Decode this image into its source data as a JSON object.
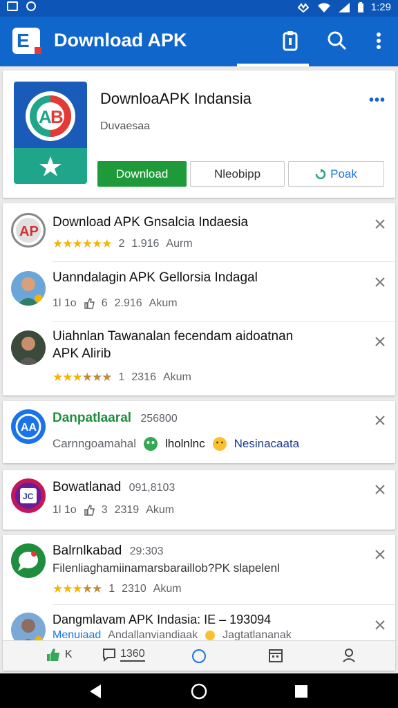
{
  "status_bar": {
    "time": "1:29"
  },
  "app_bar": {
    "title": "Download APK"
  },
  "featured": {
    "title": "DownloaAPK Indansia",
    "subtitle": "Duvaesaa",
    "more": "•••",
    "buttons": {
      "download": "Download",
      "second": "Nleobipp",
      "peak": "Poak"
    }
  },
  "list_card_1": {
    "items": [
      {
        "title": "Download APK Gnsalcia Indaesia",
        "rating_count": "2",
        "value": "1.916",
        "tag": "Aurm"
      },
      {
        "title": "Uanndalagin APK Gellorsia Indagal",
        "views": "1l 1o",
        "likes": "6",
        "value": "2.916",
        "tag": "Akum"
      },
      {
        "title_line1": "Uiahnlan Tawanalan fecendam aidoatnan",
        "title_line2": "APK Alirib",
        "rating_count": "1",
        "value": "2316",
        "tag": "Akum"
      }
    ]
  },
  "single_card": {
    "title": "Danpatlaaral",
    "number": "256800",
    "subtitle": "Carnngoamahal",
    "chip1": "lholnlnc",
    "chip2": "Nesinacaata"
  },
  "card_3": {
    "title": "Bowatlanad",
    "number": "091,8103",
    "views": "1l 1o",
    "likes": "3",
    "value": "2319",
    "tag": "Akum"
  },
  "card_4": {
    "title": "Balrnlkabad",
    "number": "29:303",
    "desc": "Filenliaghamiinamarsbaraillob?PK slapelenl",
    "rating_count": "1",
    "value": "2310",
    "tag": "Akum",
    "row2_title": "Dangmlavam APK Indasia: IE – 193094",
    "row2_sub_blue": "Menuiaad",
    "row2_sub": "Andallanviandiaak",
    "row2_sub_end": "Jagtatlananak"
  },
  "bottom_strip": {
    "k_label": "K",
    "comments": "1360"
  },
  "colors": {
    "primary": "#1166cc",
    "status_bar": "#0d56b8",
    "download_green": "#1e9a3a",
    "star": "#f4b400"
  }
}
